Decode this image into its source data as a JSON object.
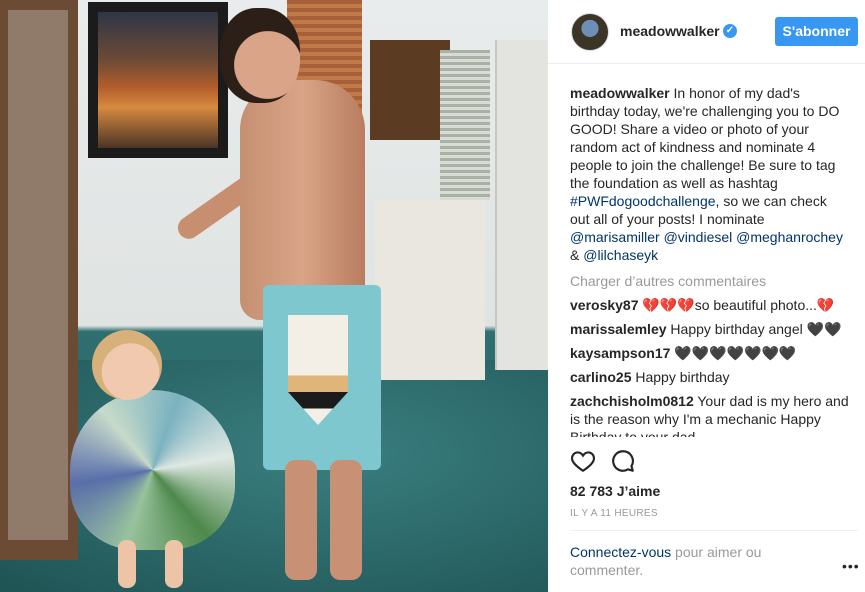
{
  "post": {
    "username": "meadowwalker",
    "verified_glyph": "✓",
    "follow_label": "S'abonner",
    "caption_user": "meadowwalker",
    "caption_text_1": " In honor of my dad's birthday today, we're challenging you to DO GOOD! Share a video or photo of your random act of kindness and nominate 4 people to join the challenge! Be sure to tag the foundation as well as hashtag ",
    "caption_hashtag": "#PWFdogoodchallenge",
    "caption_text_2": ", so we can check out all of your posts! I nominate ",
    "mention_1": "@marisamiller",
    "mention_2": "@vindiesel",
    "mention_3": "@meghanrochey",
    "amp": " & ",
    "mention_4": "@lilchaseyk",
    "load_more": "Charger d’autres commentaires",
    "comments": [
      {
        "user": "verosky87",
        "text": " 💔💔💔so beautiful photo...💔"
      },
      {
        "user": "marissalemley",
        "text": " Happy birthday angel 🖤🖤"
      },
      {
        "user": "kaysampson17",
        "text": " 🖤🖤🖤🖤🖤🖤🖤"
      },
      {
        "user": "carlino25",
        "text": " Happy birthday"
      },
      {
        "user": "zachchisholm0812",
        "text": " Your dad is my hero and is the reason why I'm a mechanic Happy Birthday to your dad"
      }
    ],
    "likes": "82 783 J’aime",
    "time": "IL Y A 11 HEURES",
    "login_link": "Connectez-vous",
    "login_text": " pour aimer ou commenter.",
    "more_glyph": "•••",
    "icons": {
      "like": "heart-icon",
      "comment": "comment-icon",
      "more": "more-options-icon"
    }
  }
}
